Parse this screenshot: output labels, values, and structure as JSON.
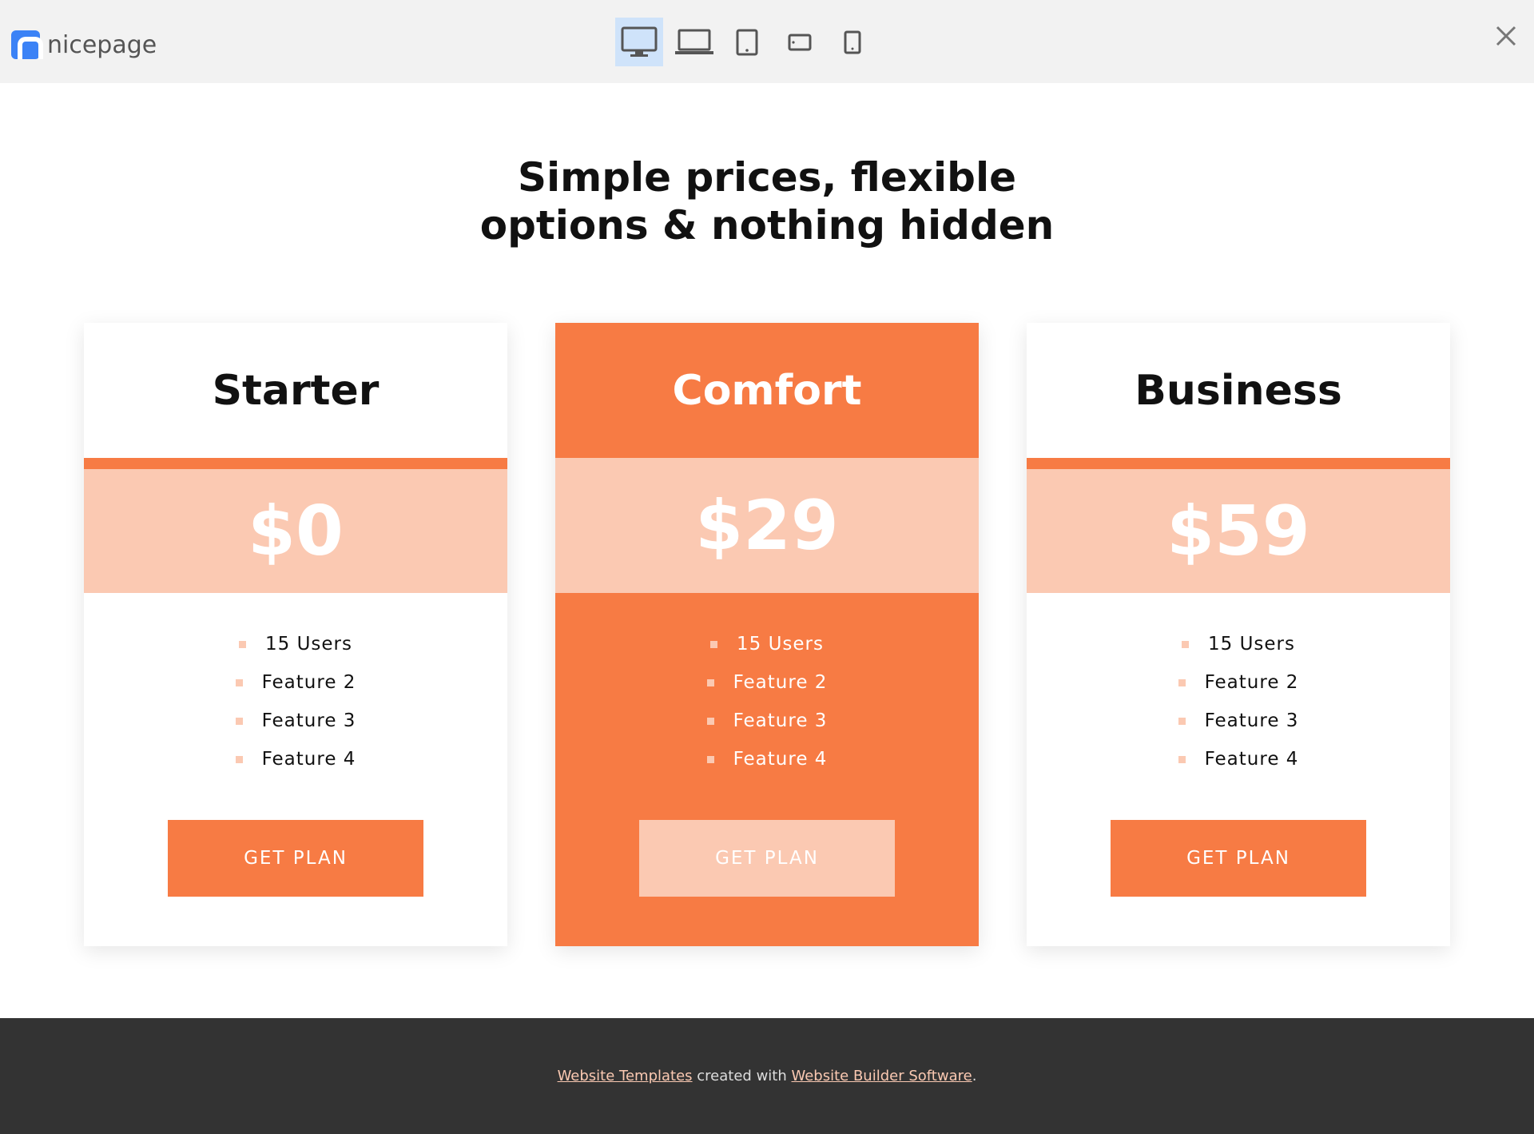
{
  "toolbar": {
    "brand": "nicepage",
    "devices": [
      {
        "name": "desktop",
        "active": true
      },
      {
        "name": "laptop",
        "active": false
      },
      {
        "name": "tablet",
        "active": false
      },
      {
        "name": "tablet-landscape",
        "active": false
      },
      {
        "name": "phone",
        "active": false
      }
    ],
    "close_icon": "close-icon",
    "active_device_color": "#cfe3fa"
  },
  "heading": {
    "line1": "Simple prices, flexible",
    "line2": "options & nothing hidden"
  },
  "plans": [
    {
      "name": "Starter",
      "price": "$0",
      "features": [
        "15 Users",
        "Feature 2",
        "Feature 3",
        "Feature 4"
      ],
      "button": "GET PLAN",
      "highlighted": false
    },
    {
      "name": "Comfort",
      "price": "$29",
      "features": [
        "15 Users",
        "Feature 2",
        "Feature 3",
        "Feature 4"
      ],
      "button": "GET PLAN",
      "highlighted": true
    },
    {
      "name": "Business",
      "price": "$59",
      "features": [
        "15 Users",
        "Feature 2",
        "Feature 3",
        "Feature 4"
      ],
      "button": "GET PLAN",
      "highlighted": false
    }
  ],
  "footer": {
    "link1": "Website Templates",
    "middle": " created with ",
    "link2": "Website Builder Software",
    "end": "."
  },
  "colors": {
    "accent": "#f77b44",
    "accent_light": "#fbc9b2",
    "footer_bg": "#333333",
    "topbar_bg": "#f2f2f2"
  }
}
